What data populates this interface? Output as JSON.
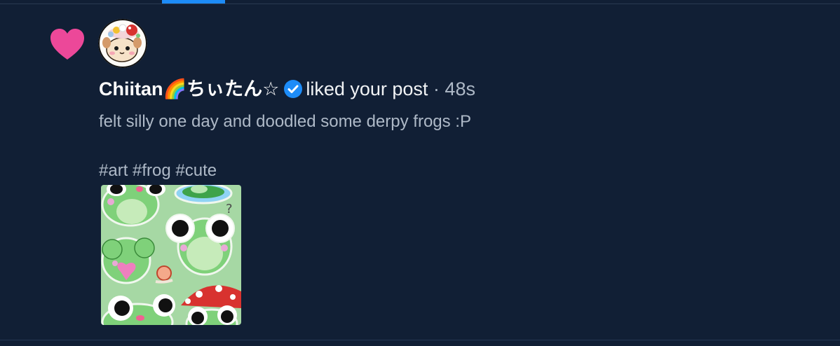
{
  "notification": {
    "user_name": "Chiitan🌈ちぃたん☆",
    "action": "liked your post",
    "separator": " · ",
    "time": "48s",
    "post_text": "felt silly one day and doodled some derpy frogs :P",
    "post_tags": "#art #frog #cute",
    "verified": true
  },
  "icons": {
    "like": "heart-icon",
    "verified": "verified-check-icon"
  },
  "colors": {
    "background": "#111f35",
    "heart": "#ec4899",
    "verified": "#1d8cf8",
    "tab_indicator": "#1d8cf8",
    "muted_text": "#aeb9c7",
    "primary_text": "#ffffff"
  }
}
